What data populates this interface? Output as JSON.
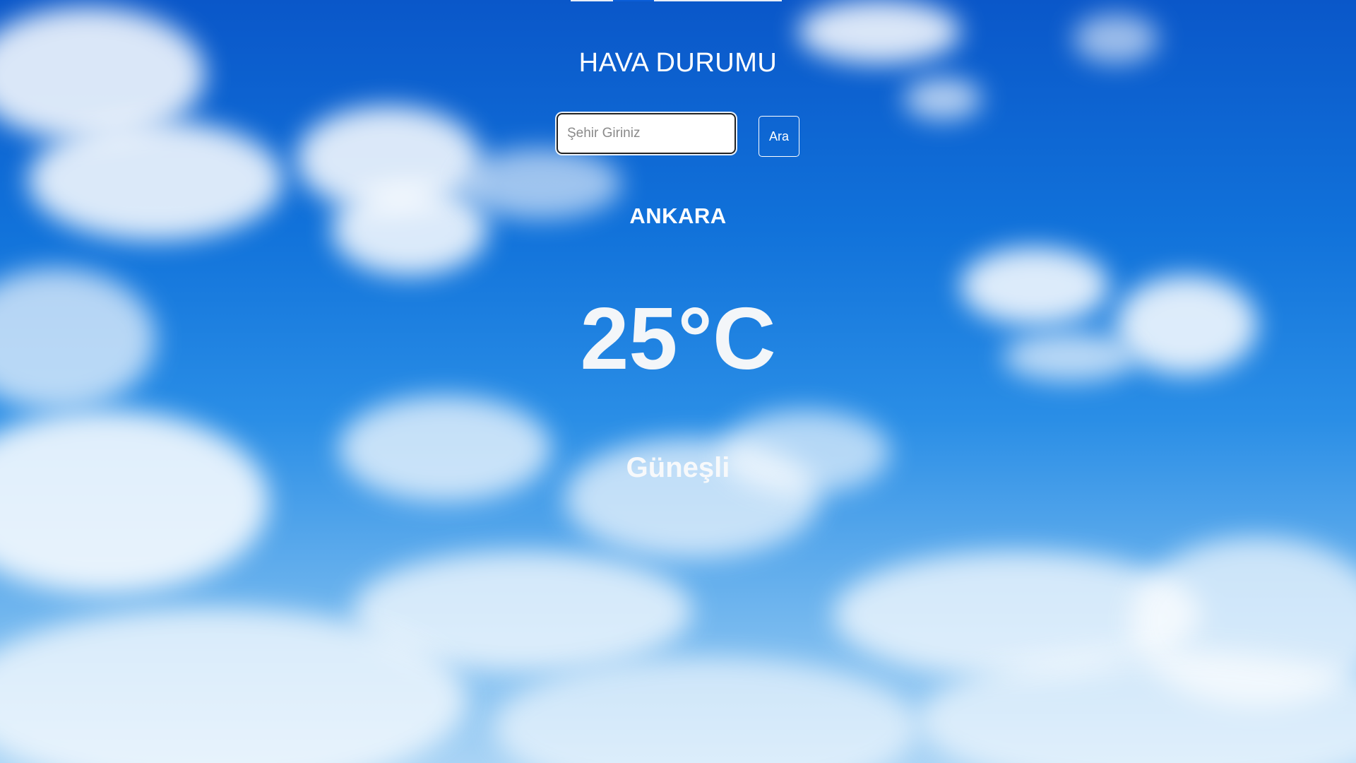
{
  "header": {
    "title": "HAVA DURUMU"
  },
  "search": {
    "placeholder": "Şehir Giriniz",
    "value": "",
    "button_label": "Ara"
  },
  "weather": {
    "city": "ANKARA",
    "temperature": "25°C",
    "condition": "Güneşli"
  },
  "colors": {
    "sky_top": "#0a57c9",
    "sky_bottom": "#a8d3f5",
    "text": "#ffffff"
  }
}
